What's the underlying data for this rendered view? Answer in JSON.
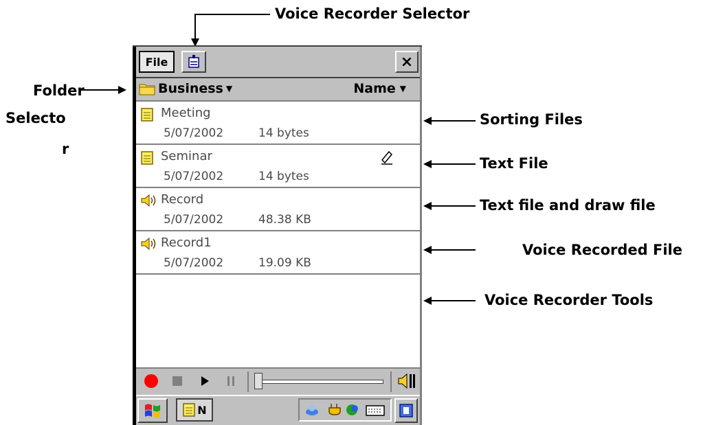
{
  "annotations": {
    "voice_recorder_selector": "Voice Recorder Selector",
    "folder_selector": "Folder",
    "folder_selector_2": "Selecto",
    "folder_selector_3": "r",
    "sorting_files": "Sorting Files",
    "text_file": "Text File",
    "text_and_draw_file": "Text file and draw file",
    "voice_recorded_file": "Voice Recorded File",
    "voice_recorder_tools": "Voice Recorder Tools"
  },
  "menubar": {
    "file_label": "File",
    "close_label": "×"
  },
  "folderbar": {
    "folder": "Business",
    "sort": "Name"
  },
  "files": [
    {
      "name": "Meeting",
      "date": "5/07/2002",
      "size": "14 bytes",
      "type": "text"
    },
    {
      "name": "Seminar",
      "date": "5/07/2002",
      "size": "14 bytes",
      "type": "text"
    },
    {
      "name": "Record",
      "date": "5/07/2002",
      "size": "48.38 KB",
      "type": "audio"
    },
    {
      "name": "Record1",
      "date": "5/07/2002",
      "size": "19.09 KB",
      "type": "audio"
    }
  ],
  "taskbar": {
    "app_label": "N"
  },
  "colors": {
    "record": "#ff0000",
    "chrome": "#c0c0c0",
    "text_gray": "#4a4a4a"
  },
  "icons": [
    "windows-start-icon",
    "notes-icon",
    "record-icon",
    "stop-icon",
    "play-icon",
    "pause-icon",
    "volume-icon",
    "pen-icon",
    "speaker-icon",
    "folder-icon"
  ]
}
